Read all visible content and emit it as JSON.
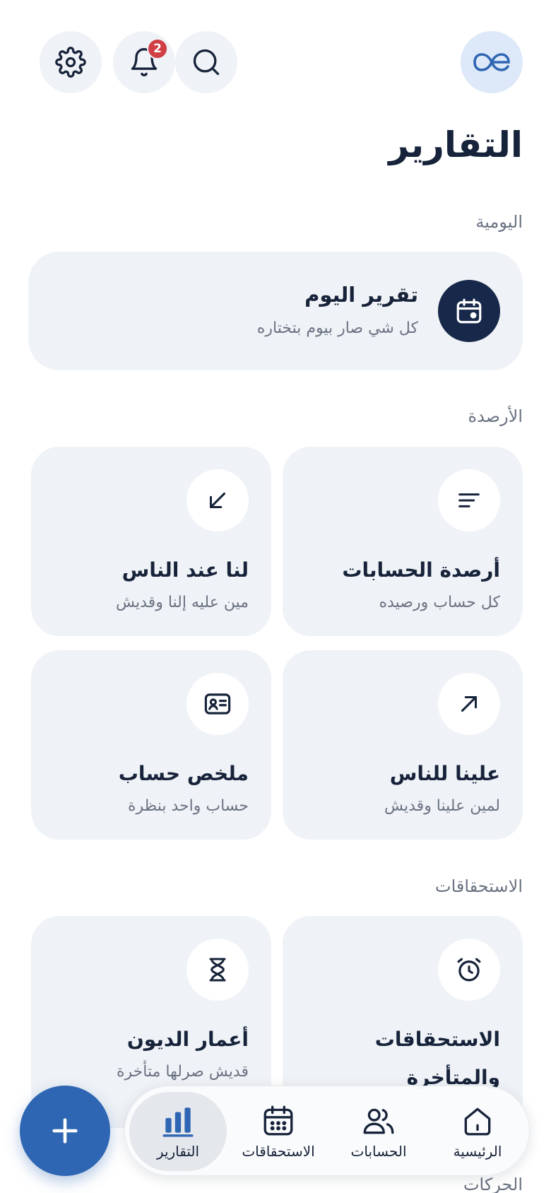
{
  "header": {
    "notification_count": "2",
    "icons": [
      "settings-icon",
      "bell-icon",
      "search-icon",
      "app-logo"
    ]
  },
  "page_title": "التقارير",
  "sections": {
    "daily": "اليومية",
    "balances": "الأرصدة",
    "dues": "الاستحقاقات",
    "movements": "الحركات"
  },
  "daily_card": {
    "title": "تقرير اليوم",
    "subtitle": "كل شي صار بيوم بتختاره",
    "icon": "calendar-icon"
  },
  "balance_cards": [
    {
      "title": "أرصدة الحسابات",
      "subtitle": "كل حساب ورصيده",
      "icon": "sort-lines-icon"
    },
    {
      "title": "لنا عند الناس",
      "subtitle": "مين عليه إلنا وقديش",
      "icon": "arrow-down-left-icon"
    },
    {
      "title": "علينا للناس",
      "subtitle": "لمين علينا وقديش",
      "icon": "arrow-up-right-icon"
    },
    {
      "title": "ملخص حساب",
      "subtitle": "حساب واحد بنظرة",
      "icon": "id-card-icon"
    }
  ],
  "dues_cards": [
    {
      "title_line1": "الاستحقاقات",
      "title_line2": "والمتأخرة",
      "icon": "alarm-clock-icon"
    },
    {
      "title": "أعمار الديون",
      "subtitle": "قديش صرلها متأخرة",
      "icon": "hourglass-icon"
    }
  ],
  "bottom_nav": {
    "items": [
      {
        "label": "الرئيسية",
        "icon": "home-icon",
        "active": false
      },
      {
        "label": "الحسابات",
        "icon": "users-icon",
        "active": false
      },
      {
        "label": "الاستحقاقات",
        "icon": "calendar-grid-icon",
        "active": false
      },
      {
        "label": "التقارير",
        "icon": "bar-chart-icon",
        "active": true
      }
    ]
  },
  "colors": {
    "primary_dark": "#17284a",
    "accent_blue": "#2f66b3",
    "card_bg": "#eff2f6",
    "badge_red": "#cf3f44"
  }
}
